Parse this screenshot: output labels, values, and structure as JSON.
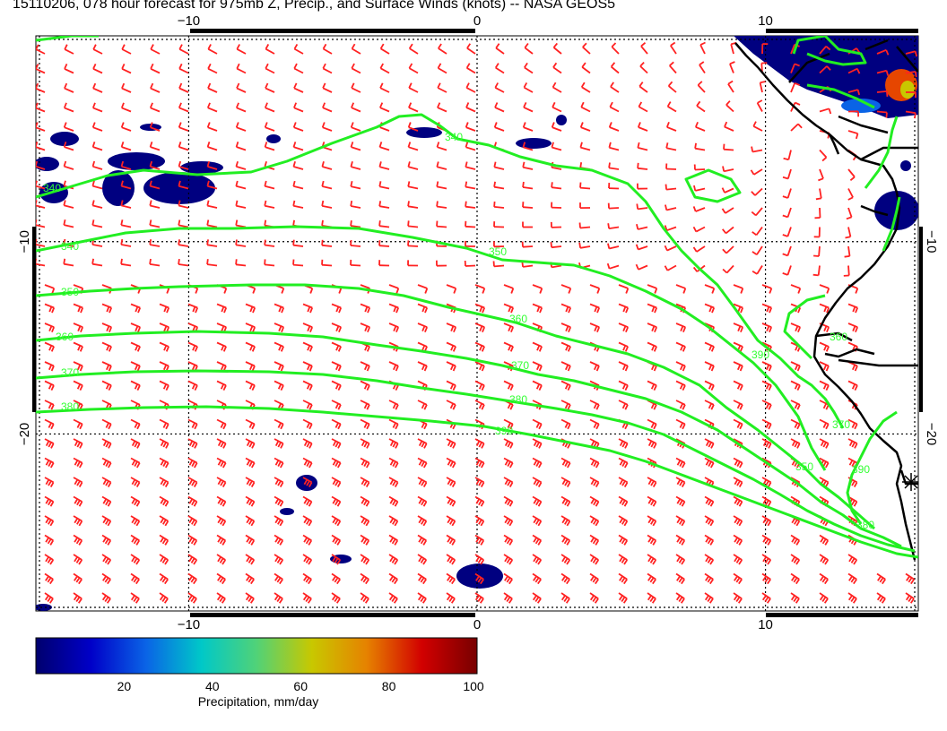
{
  "title": "15110206, 078 hour forecast for 975mb Z, Precip., and Surface Winds (knots) -- NASA GEOS5",
  "map": {
    "x_ticks_top": [
      {
        "label": "−10",
        "x": -10
      },
      {
        "label": "0",
        "x": 0
      },
      {
        "label": "10",
        "x": 10
      }
    ],
    "x_ticks_bottom": [
      {
        "label": "−10",
        "x": -10
      },
      {
        "label": "0",
        "x": 0
      },
      {
        "label": "10",
        "x": 10
      }
    ],
    "y_ticks_left": [
      {
        "label": "−10",
        "y": -10
      },
      {
        "label": "−20",
        "y": -20
      }
    ],
    "y_ticks_right": [
      {
        "label": "−10",
        "y": -10
      },
      {
        "label": "−20",
        "y": -20
      }
    ],
    "x_range": [
      -15.3,
      15.3
    ],
    "y_range": [
      -29.2,
      0.7
    ],
    "gridlines": "dotted",
    "contour_labels": [
      "340",
      "350",
      "360",
      "370",
      "380",
      "390",
      "340",
      "350",
      "360",
      "370",
      "380",
      "390",
      "340",
      "350",
      "360",
      "370",
      "380",
      "390"
    ],
    "colors": {
      "contour": "#22ee22",
      "wind_barb": "#ff2222",
      "coast": "#000000",
      "precip_low": "#000080"
    }
  },
  "colorbar": {
    "label": "Precipitation, mm/day",
    "ticks": [
      {
        "label": "20",
        "v": 20
      },
      {
        "label": "40",
        "v": 40
      },
      {
        "label": "60",
        "v": 60
      },
      {
        "label": "80",
        "v": 80
      },
      {
        "label": "100",
        "v": 100
      }
    ],
    "range": [
      0,
      100
    ],
    "stops": [
      "#00006e",
      "#0000c8",
      "#0a64e6",
      "#00c8c8",
      "#50d278",
      "#c8c800",
      "#e68200",
      "#d20000",
      "#780000"
    ]
  }
}
